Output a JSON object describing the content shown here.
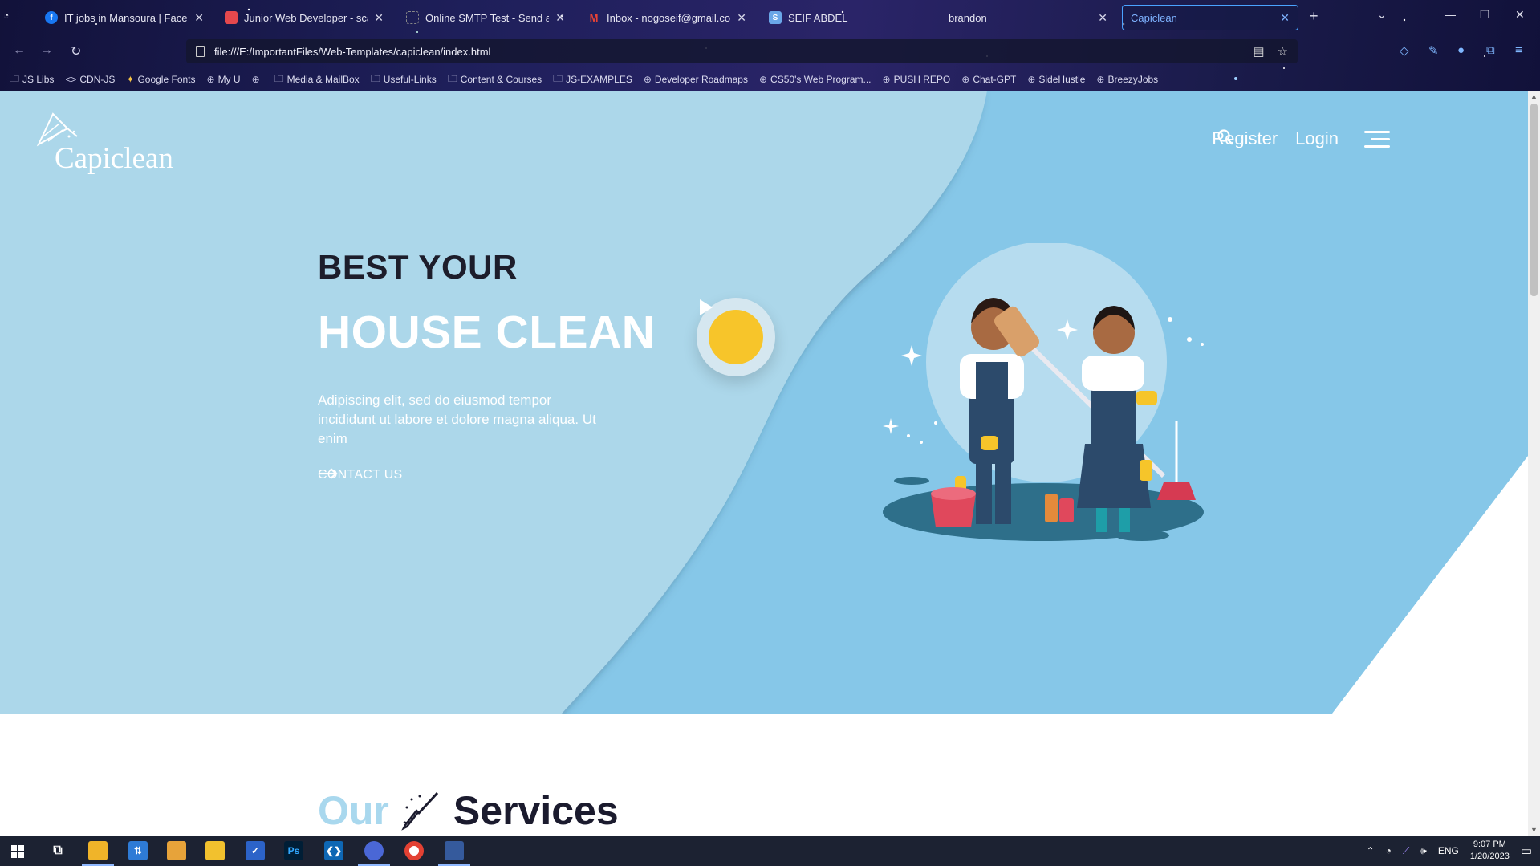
{
  "browser": {
    "tabs": [
      {
        "label": "IT jobs in Mansoura | Facebook",
        "favicon": "facebook-icon",
        "color": "#1877f2"
      },
      {
        "label": "Junior Web Developer - scandiweb",
        "favicon": "scandiweb-icon",
        "color": "#e5484d"
      },
      {
        "label": "Online SMTP Test - Send and Check",
        "favicon": "grid-icon",
        "color": "#555555"
      },
      {
        "label": "Inbox - nogoseif@gmail.com",
        "favicon": "gmail-icon",
        "color": "#ea4335"
      },
      {
        "label": "SEIF ABDEL",
        "favicon": "doc-icon",
        "color": "#6aa6e8"
      },
      {
        "label": "brandon",
        "favicon": "",
        "color": ""
      },
      {
        "label": "Capiclean",
        "favicon": "",
        "color": "",
        "active": true
      }
    ],
    "url": "file:///E:/ImportantFiles/Web-Templates/capiclean/index.html",
    "bookmarks": [
      {
        "label": "JS Libs",
        "icon": "folder-icon"
      },
      {
        "label": "CDN-JS",
        "icon": "code-icon"
      },
      {
        "label": "Google Fonts",
        "icon": "google-fonts-icon"
      },
      {
        "label": "My U",
        "icon": "globe-icon"
      },
      {
        "label": "",
        "icon": "globe-icon"
      },
      {
        "label": "Media & MailBox",
        "icon": "folder-icon"
      },
      {
        "label": "Useful-Links",
        "icon": "folder-icon"
      },
      {
        "label": "Content & Courses",
        "icon": "folder-icon"
      },
      {
        "label": "JS-EXAMPLES",
        "icon": "folder-icon"
      },
      {
        "label": "Developer Roadmaps",
        "icon": "globe-icon"
      },
      {
        "label": "CS50's Web Program...",
        "icon": "globe-icon"
      },
      {
        "label": "PUSH REPO",
        "icon": "globe-icon"
      },
      {
        "label": "Chat-GPT",
        "icon": "globe-icon"
      },
      {
        "label": "SideHustle",
        "icon": "globe-icon"
      },
      {
        "label": "BreezyJobs",
        "icon": "globe-icon"
      }
    ]
  },
  "site": {
    "brand": "Capiclean",
    "nav": {
      "register": "Register",
      "login": "Login"
    },
    "hero": {
      "kicker": "BEST YOUR",
      "title": "HOUSE CLEAN",
      "lead": "Adipiscing elit, sed do eiusmod tempor incididunt ut labore et dolore magna aliqua. Ut enim",
      "cta": "CONTACT US"
    },
    "services": {
      "part1": "Our",
      "part2": "Services"
    },
    "colors": {
      "hero_light": "#acd7ea",
      "hero_dark": "#86c7e8",
      "accent": "#f7c52a",
      "heading_dark": "#1d1d2b"
    }
  },
  "taskbar": {
    "language": "ENG",
    "time": "9:07 PM",
    "date": "1/20/2023"
  }
}
